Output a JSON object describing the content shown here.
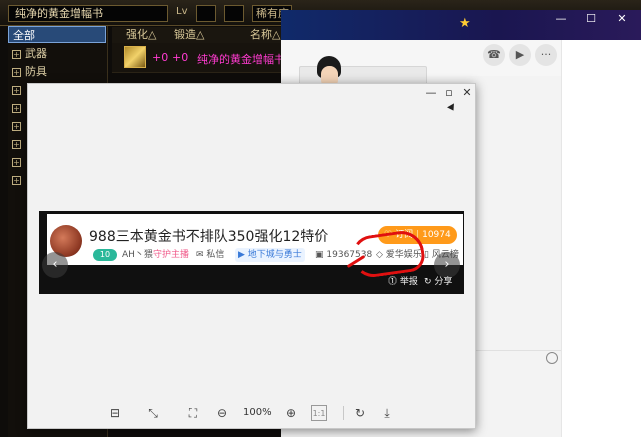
{
  "game": {
    "search_value": "纯净的黄金增幅书",
    "level_label": "Lv",
    "rarity_value": "稀有度",
    "categories": [
      {
        "label": "全部",
        "selected": true
      },
      {
        "label": "武器",
        "selected": false
      },
      {
        "label": "防具",
        "selected": false
      }
    ],
    "columns": {
      "enhance": "强化△",
      "forge": "锻造△",
      "name": "名称△"
    },
    "row": {
      "enhance": "+0",
      "forge": "+0",
      "name": "纯净的黄金增幅书"
    },
    "colors": {
      "item_name": "#ff3bd0",
      "selected_category": "#284a78"
    }
  },
  "chat": {
    "header_icon": "star-icon",
    "toolbar_icons": [
      "phone-icon",
      "video-icon",
      "more-icon"
    ],
    "window_controls": [
      "minimize-icon",
      "maximize-icon",
      "close-icon"
    ],
    "footer_icon": "clock-icon",
    "header_colors": [
      "#102a6a",
      "#2a1a5a"
    ]
  },
  "viewer": {
    "window_controls": [
      "minimize-icon",
      "maximize-icon",
      "close-icon"
    ],
    "stream": {
      "title": "988三本黄金书不排队350强化12特价",
      "subscribe_label": "订阅",
      "subscribe_count": "10974",
      "level": "10",
      "streamer": "AH丶猥",
      "guardian_label": "守护主播",
      "message_label": "私信",
      "category_label": "地下城与勇士",
      "viewer_count": "19367538",
      "channel_label": "爱华娱乐",
      "extra_label": "风云榜",
      "report_label": "举报",
      "share_label": "分享",
      "accent_color": "#ff9a1a",
      "annotation_color": "#e01010"
    },
    "toolbar": {
      "zoom_value": "100%",
      "icons": [
        "thumbnails-icon",
        "fit-screen-icon",
        "actual-size-icon",
        "zoom-out-icon",
        "zoom-in-icon",
        "one-to-one-icon",
        "rotate-icon",
        "download-icon"
      ],
      "one_to_one_label": "1:1"
    }
  }
}
